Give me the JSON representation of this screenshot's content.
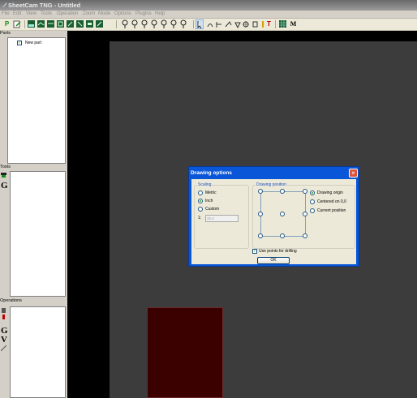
{
  "window": {
    "title": "SheetCam TNG - Untitled"
  },
  "menu": [
    "File",
    "Edit",
    "View",
    "Tools",
    "Operation",
    "Zoom",
    "Mode",
    "Options",
    "Plugins",
    "Help"
  ],
  "toolbar": {
    "t_label": "T",
    "m_label": "M",
    "p_label": "P"
  },
  "parts_panel": {
    "title": "Parts",
    "item_label": "New part",
    "item_checked": true
  },
  "tools_panel": {
    "title": "Tools",
    "icon_label": "G"
  },
  "operations_panel": {
    "title": "Operations",
    "icon_labels": [
      "G",
      "V"
    ]
  },
  "dialog": {
    "title": "Drawing options",
    "scaling": {
      "title": "Scaling",
      "options": [
        "Metric",
        "Inch",
        "Custom"
      ],
      "selected": "Inch",
      "ratio_prefix": "1:",
      "ratio_value": "25.4"
    },
    "position": {
      "title": "Drawing position",
      "options": [
        "Drawing origin",
        "Centered on 0,0",
        "Current position"
      ],
      "selected": "Drawing origin"
    },
    "use_points_label": "Use points for drilling",
    "use_points_checked": true,
    "ok_label": "OK"
  },
  "colors": {
    "canvas": "#3c3c3c",
    "part_fill": "#3b0000",
    "dialog_title": "#0a56d8",
    "close": "#d9553a"
  }
}
